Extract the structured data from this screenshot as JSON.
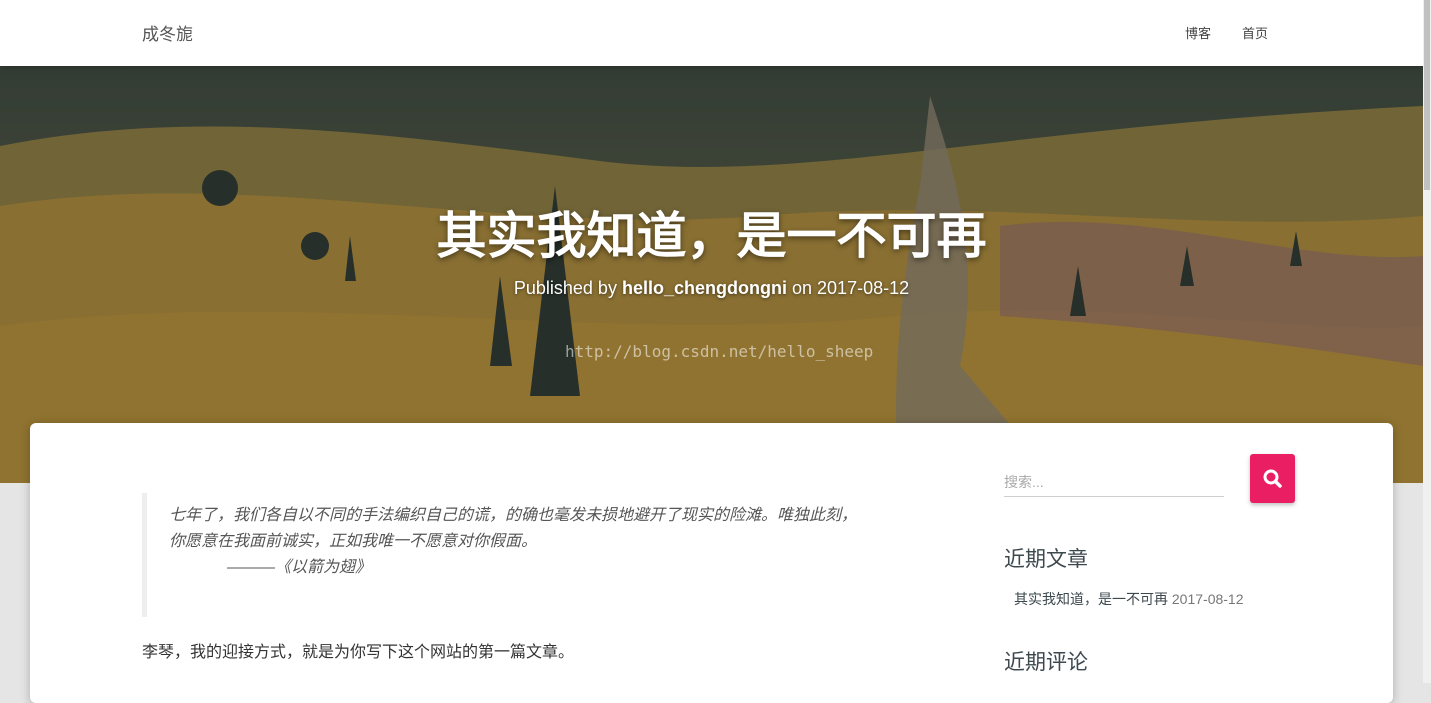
{
  "navbar": {
    "brand": "成冬旎",
    "links": [
      {
        "label": "博客"
      },
      {
        "label": "首页"
      }
    ]
  },
  "hero": {
    "title": "其实我知道，是一不可再",
    "meta_prefix": "Published by",
    "author": "hello_chengdongni",
    "meta_on": "on",
    "date": "2017-08-12",
    "watermark": "http://blog.csdn.net/hello_sheep"
  },
  "post": {
    "quote_text": "七年了，我们各自以不同的手法编织自己的谎，的确也毫发未损地避开了现实的险滩。唯独此刻，你愿意在我面前诚实，正如我唯一不愿意对你假面。",
    "quote_cite": "———《以箭为翅》",
    "paragraph": "李琴，我的迎接方式，就是为你写下这个网站的第一篇文章。"
  },
  "sidebar": {
    "search_placeholder": "搜索...",
    "recent_posts_title": "近期文章",
    "recent_posts": [
      {
        "title": "其实我知道，是一不可再",
        "date": "2017-08-12"
      }
    ],
    "recent_comments_title": "近期评论"
  },
  "colors": {
    "accent": "#e91e63",
    "text": "#3c484e"
  }
}
